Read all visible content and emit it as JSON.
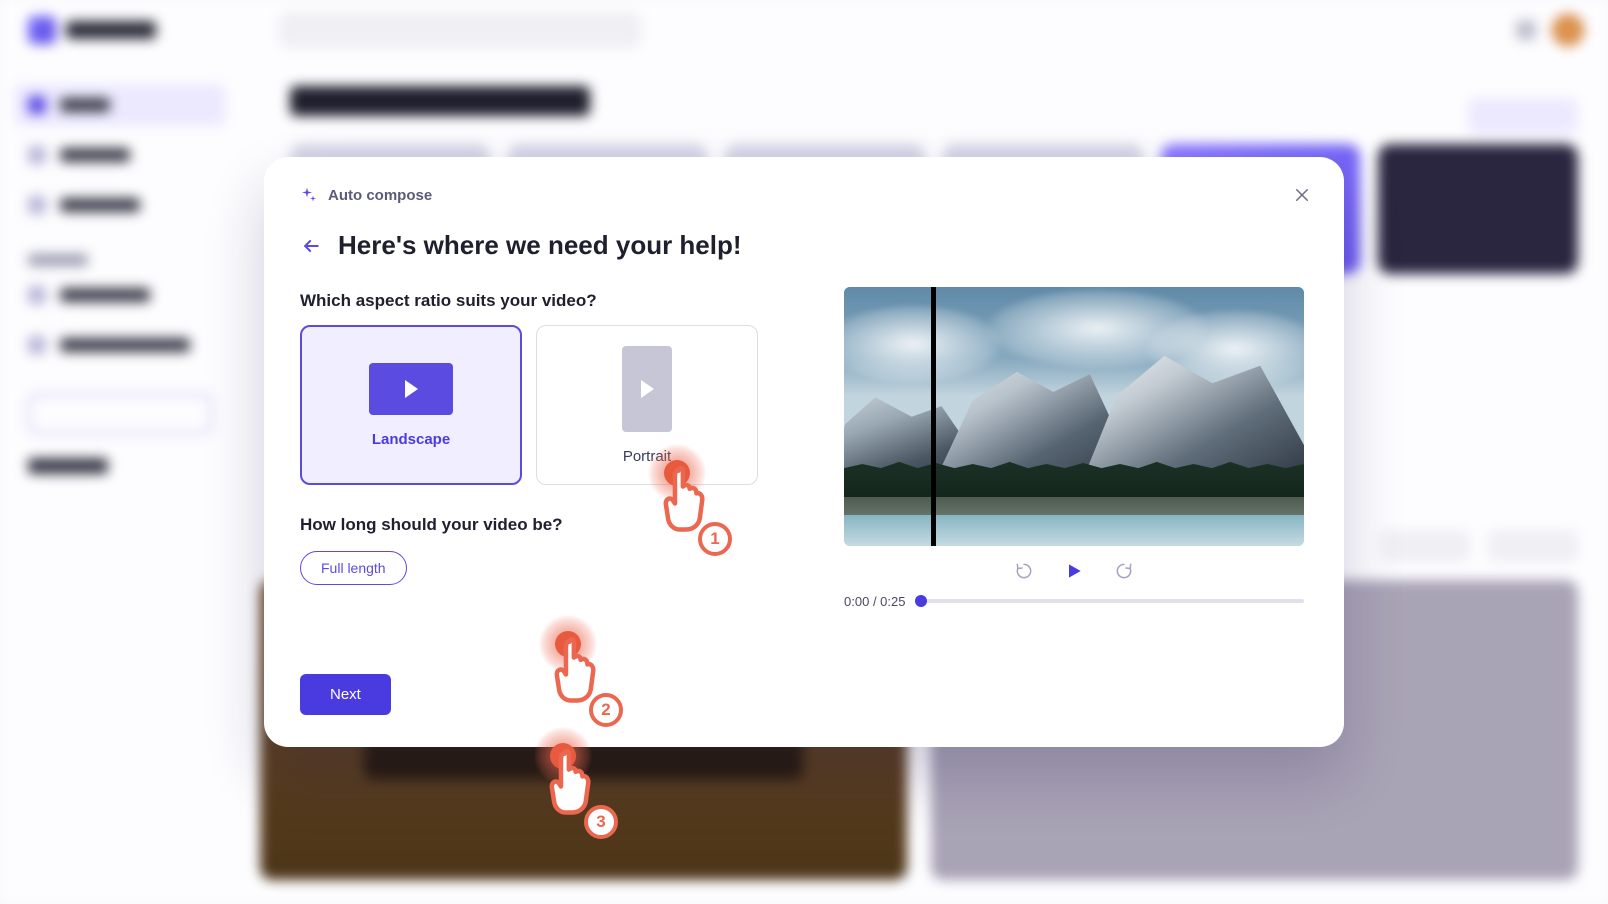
{
  "modal": {
    "breadcrumb": "Auto compose",
    "title": "Here's where we need your help!",
    "aspect_question": "Which aspect ratio suits your video?",
    "aspect_options": {
      "landscape": "Landscape",
      "portrait": "Portrait"
    },
    "aspect_selected": "landscape",
    "length_question": "How long should your video be?",
    "length_option": "Full length",
    "next_label": "Next",
    "preview": {
      "time_current": "0:00",
      "time_total": "0:25"
    }
  },
  "markers": {
    "step1": "1",
    "step2": "2",
    "step3": "3"
  },
  "colors": {
    "accent": "#4a3be0",
    "marker": "#ec6750"
  }
}
